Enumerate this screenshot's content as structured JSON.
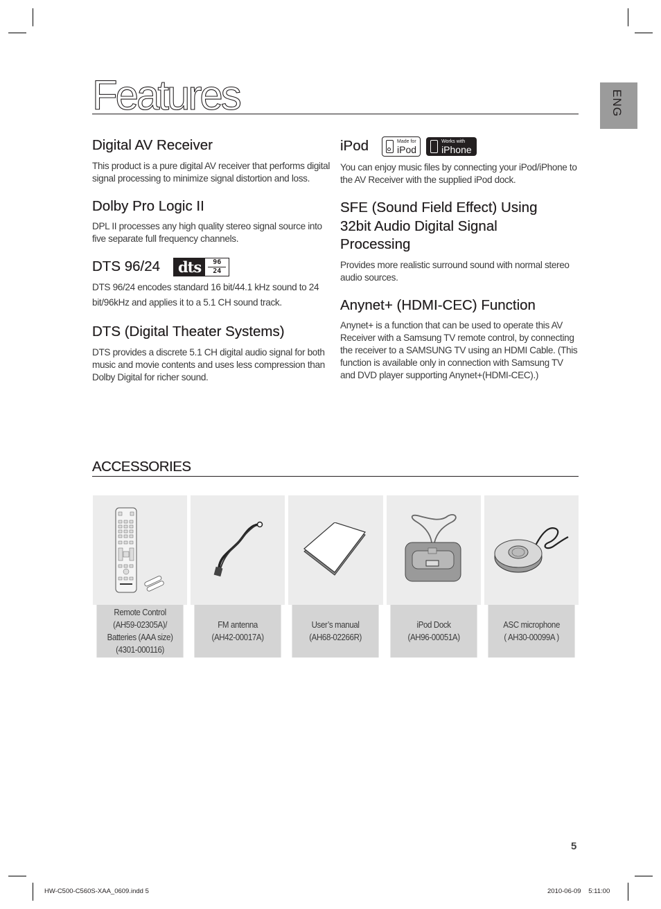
{
  "page": {
    "title": "Features",
    "language_tab": "ENG",
    "page_number": "5",
    "slug_left": "HW-C500-C560S-XAA_0609.indd   5",
    "slug_right": "2010-06-09   5:11:00"
  },
  "features_left": [
    {
      "heading": "Digital AV Receiver",
      "body": "This product is a pure digital AV receiver that performs digital signal processing to minimize signal distortion and loss."
    },
    {
      "heading": "Dolby Pro Logic II",
      "body": "DPL II processes any high quality stereo signal source into five separate full frequency channels."
    },
    {
      "heading": "DTS 96/24",
      "logo": {
        "name": "dts-96-24-logo",
        "main": "dts",
        "top": "96",
        "bottom": "24"
      },
      "body": "DTS 96/24 encodes standard 16 bit/44.1 kHz sound to 24 bit/96kHz and applies it to a 5.1 CH sound track."
    },
    {
      "heading": "DTS (Digital Theater Systems)",
      "body": "DTS provides a discrete 5.1 CH digital audio signal for both music and movie contents and uses less compression than Dolby Digital for richer sound."
    }
  ],
  "features_right": [
    {
      "heading": "iPod",
      "badges": [
        {
          "small": "Made for",
          "big": "iPod"
        },
        {
          "small": "Works with",
          "big": "iPhone"
        }
      ],
      "body": "You can enjoy music files by connecting your iPod/iPhone to the AV Receiver with the supplied iPod dock."
    },
    {
      "heading": "SFE (Sound Field Effect) Using 32bit Audio Digital Signal Processing",
      "body": "Provides more realistic surround sound with normal stereo audio sources."
    },
    {
      "heading": "Anynet+ (HDMI-CEC) Function",
      "body": "Anynet+ is a function that can be used to operate this AV Receiver with a Samsung TV remote control, by connecting the receiver to a SAMSUNG TV using an HDMI Cable.  (This function is available only in connection with Samsung TV and DVD player supporting Anynet+(HDMI-CEC).)"
    }
  ],
  "accessories": {
    "heading": "ACCESSORIES",
    "items": [
      {
        "icon": "remote-control-icon",
        "caption": "Remote Control\n(AH59-02305A)/\nBatteries (AAA size)\n(4301-000116)"
      },
      {
        "icon": "fm-antenna-icon",
        "caption": "FM antenna\n(AH42-00017A)"
      },
      {
        "icon": "user-manual-icon",
        "caption": "User’s manual\n(AH68-02266R)"
      },
      {
        "icon": "ipod-dock-icon",
        "caption": "iPod Dock\n(AH96-00051A)"
      },
      {
        "icon": "asc-microphone-icon",
        "caption": "ASC microphone\n( AH30-00099A )"
      }
    ]
  }
}
